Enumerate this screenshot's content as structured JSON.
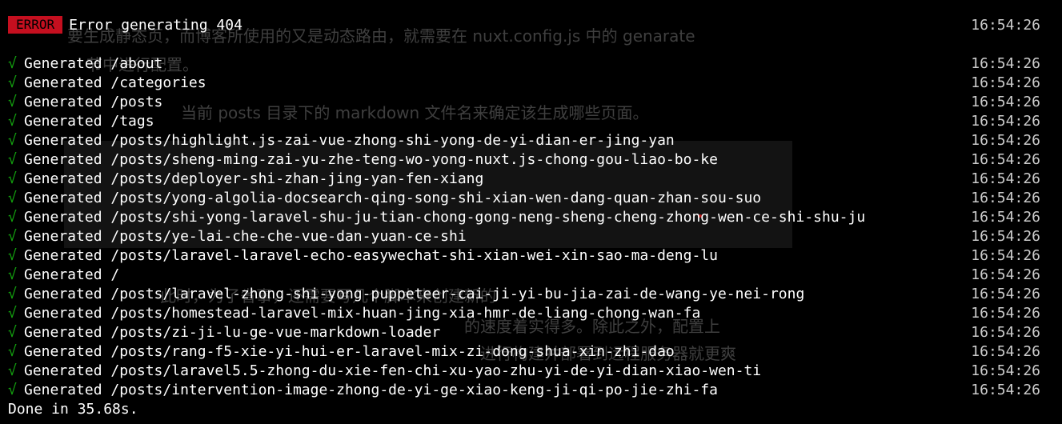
{
  "error": {
    "badge": "ERROR",
    "message": "Error generating 404",
    "time": "16:54:26"
  },
  "check_symbol": "√",
  "generated": [
    {
      "text": "Generated /about",
      "time": "16:54:26"
    },
    {
      "text": "Generated /categories",
      "time": "16:54:26"
    },
    {
      "text": "Generated /posts",
      "time": "16:54:26"
    },
    {
      "text": "Generated /tags",
      "time": "16:54:26"
    },
    {
      "text": "Generated /posts/highlight.js-zai-vue-zhong-shi-yong-de-yi-dian-er-jing-yan",
      "time": "16:54:26"
    },
    {
      "text": "Generated /posts/sheng-ming-zai-yu-zhe-teng-wo-yong-nuxt.js-chong-gou-liao-bo-ke",
      "time": "16:54:26"
    },
    {
      "text": "Generated /posts/deployer-shi-zhan-jing-yan-fen-xiang",
      "time": "16:54:26"
    },
    {
      "text": "Generated /posts/yong-algolia-docsearch-qing-song-shi-xian-wen-dang-quan-zhan-sou-suo",
      "time": "16:54:26"
    },
    {
      "text": "Generated /posts/shi-yong-laravel-shu-ju-tian-chong-gong-neng-sheng-cheng-zhong-wen-ce-shi-shu-ju",
      "time": "16:54:26"
    },
    {
      "text": "Generated /posts/ye-lai-che-che-vue-dan-yuan-ce-shi",
      "time": "16:54:26"
    },
    {
      "text": "Generated /posts/laravel-laravel-echo-easywechat-shi-xian-wei-xin-sao-ma-deng-lu",
      "time": "16:54:26"
    },
    {
      "text": "Generated /",
      "time": "16:54:26"
    },
    {
      "text": "Generated /posts/laravel-zhong-shi-yong-puppeteer-cai-ji-yi-bu-jia-zai-de-wang-ye-nei-rong",
      "time": "16:54:26"
    },
    {
      "text": "Generated /posts/homestead-laravel-mix-huan-jing-xia-hmr-de-liang-chong-wan-fa",
      "time": "16:54:26"
    },
    {
      "text": "Generated /posts/zi-ji-lu-ge-vue-markdown-loader",
      "time": "16:54:26"
    },
    {
      "text": "Generated /posts/rang-f5-xie-yi-hui-er-laravel-mix-zi-dong-shua-xin-zhi-dao",
      "time": "16:54:26"
    },
    {
      "text": "Generated /posts/laravel5.5-zhong-du-xie-fen-chi-xu-yao-zhu-yi-de-yi-dian-xiao-wen-ti",
      "time": "16:54:26"
    },
    {
      "text": "Generated /posts/intervention-image-zhong-de-yi-ge-xiao-keng-ji-qi-po-jie-zhi-fa",
      "time": "16:54:26"
    }
  ],
  "done": "Done in 35.68s.",
  "ghost_text": [
    "要生成静态页，而博客所使用的又是动态路由，就需要在 nuxt.config.js 中的 genarate",
    "节中进行配置。",
    "当前 posts 目录下的 markdown 文件名来确定该生成哪些页面。",
    "此时，为了省事，还需要写几个脚本来创建新的",
    "的速度着实得多。除此之外，配置上",
    "进行构建并部署到远程服务器就更爽"
  ],
  "colors": {
    "background": "#000000",
    "error_badge": "#c50f1f",
    "check": "#13a10e",
    "text": "#ffffff",
    "timestamp": "#cccccc"
  }
}
